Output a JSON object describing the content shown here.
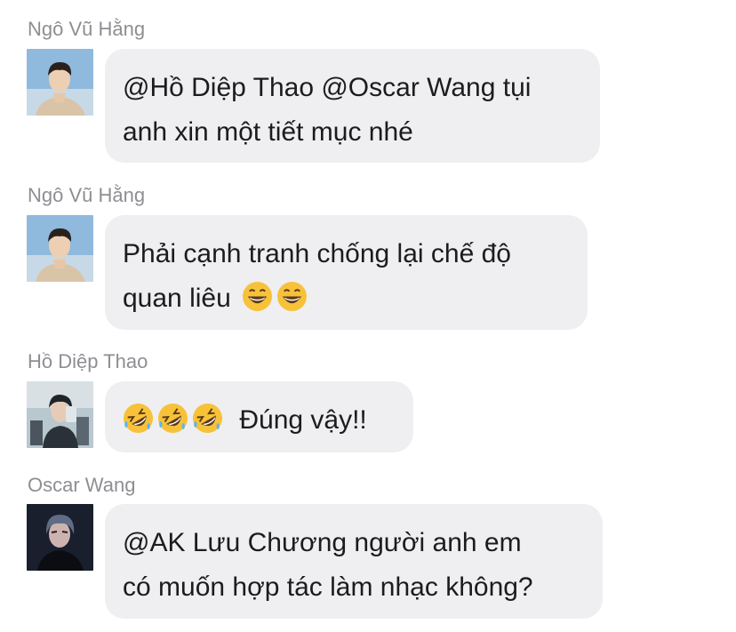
{
  "chat": {
    "messages": [
      {
        "sender": "Ngô Vũ Hằng",
        "avatar": "avatar-young-man-blue-sky",
        "line1": "@Hồ Diệp Thao @Oscar Wang tụi",
        "line2": "anh xin một tiết mục nhé"
      },
      {
        "sender": "Ngô Vũ Hằng",
        "avatar": "avatar-young-man-blue-sky",
        "line1": "Phải cạnh tranh chống lại chế độ",
        "line2": "quan liêu",
        "line2_emojis": [
          "grinning-face-icon",
          "grinning-face-icon"
        ]
      },
      {
        "sender": "Hồ Diệp Thao",
        "avatar": "avatar-man-mirror-selfie",
        "line1_emojis": [
          "rolling-on-floor-laughing-icon",
          "rolling-on-floor-laughing-icon",
          "rolling-on-floor-laughing-icon"
        ],
        "line1": "Đúng vậy!!"
      },
      {
        "sender": "Oscar Wang",
        "avatar": "avatar-man-dark-portrait",
        "line1": "@AK Lưu Chương người anh em",
        "line2": "có muốn hợp tác làm nhạc không?"
      }
    ]
  },
  "colors": {
    "bubble_bg": "#efeff1",
    "sender_text": "#8e8e93",
    "message_text": "#1c1c1e"
  }
}
